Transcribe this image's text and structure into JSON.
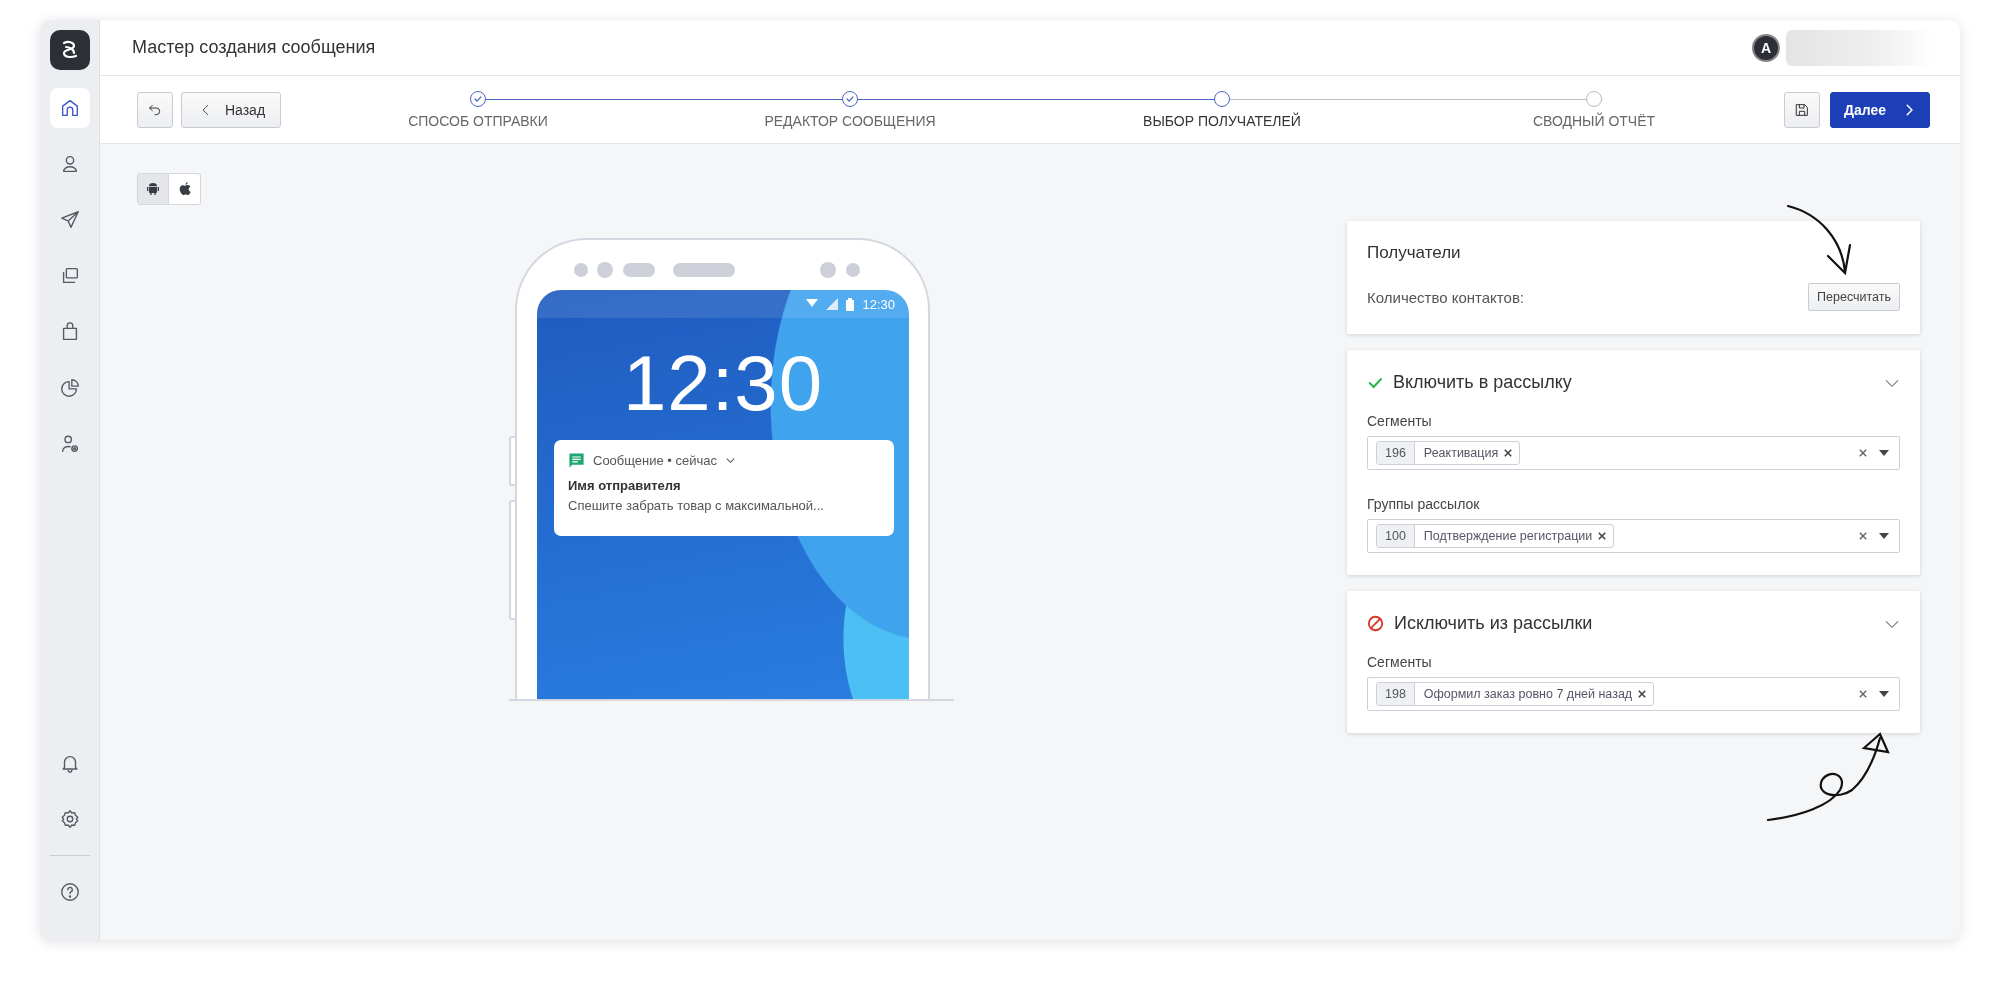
{
  "header": {
    "title": "Мастер создания сообщения",
    "avatar_initial": "A"
  },
  "sidebar": {
    "items": [
      {
        "selected": true
      },
      {
        "selected": false
      },
      {
        "selected": false
      },
      {
        "selected": false
      },
      {
        "selected": false
      },
      {
        "selected": false
      },
      {
        "selected": false
      }
    ],
    "bottom_items": [
      {
        "selected": false
      },
      {
        "selected": false
      },
      {
        "selected": false
      }
    ]
  },
  "toolbar": {
    "back_label": "Назад",
    "next_label": "Далее"
  },
  "steps": [
    {
      "label": "СПОСОБ ОТПРАВКИ",
      "completed": true,
      "current": false
    },
    {
      "label": "РЕДАКТОР СООБЩЕНИЯ",
      "completed": true,
      "current": false
    },
    {
      "label": "ВЫБОР ПОЛУЧАТЕЛЕЙ",
      "completed": false,
      "current": true
    },
    {
      "label": "СВОДНЫЙ ОТЧЁТ",
      "completed": false,
      "current": false
    }
  ],
  "platform_tabs": [
    {
      "selected": true
    },
    {
      "selected": false
    }
  ],
  "phone_preview": {
    "status_time": "12:30",
    "clock": "12:30",
    "notification": {
      "app": "Сообщение • сейчас",
      "sender": "Имя отправителя",
      "text": "Спешите забрать товар с максимальной..."
    }
  },
  "recipients": {
    "title": "Получатели",
    "count_label": "Количество контактов:",
    "recalc_button": "Пересчитать"
  },
  "filter_sections": [
    {
      "kind": "include",
      "title": "Включить в рассылку",
      "fields": [
        {
          "label": "Сегменты",
          "tags": [
            {
              "id": "196",
              "name": "Реактивация"
            }
          ]
        },
        {
          "label": "Группы рассылок",
          "tags": [
            {
              "id": "100",
              "name": "Подтверждение регистрации"
            }
          ]
        }
      ]
    },
    {
      "kind": "exclude",
      "title": "Исключить из рассылки",
      "fields": [
        {
          "label": "Сегменты",
          "tags": [
            {
              "id": "198",
              "name": "Оформил заказ ровно 7 дней назад"
            }
          ]
        }
      ]
    }
  ]
}
